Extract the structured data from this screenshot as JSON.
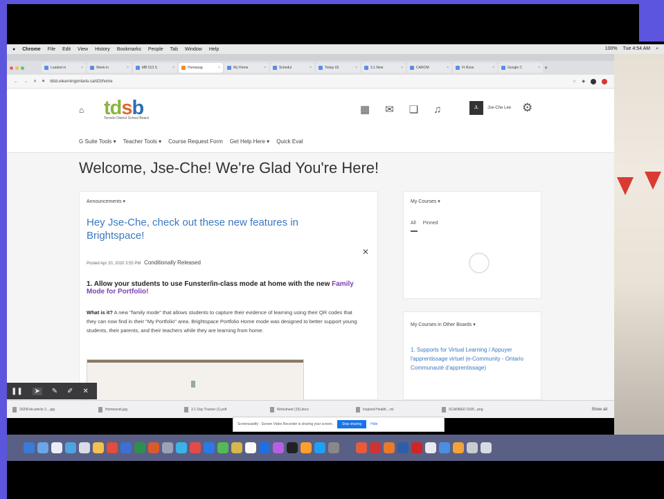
{
  "menubar": {
    "apple": "",
    "items": [
      "Chrome",
      "File",
      "Edit",
      "View",
      "History",
      "Bookmarks",
      "People",
      "Tab",
      "Window",
      "Help"
    ],
    "right": [
      "100%",
      "Tue 4:54 AM"
    ]
  },
  "window_title": "",
  "tabs": [
    {
      "label": "Loaded m",
      "active": false
    },
    {
      "label": "Week in",
      "active": false
    },
    {
      "label": "MB 013 S",
      "active": false
    },
    {
      "label": "Homepag",
      "active": true
    },
    {
      "label": "My Home",
      "active": false
    },
    {
      "label": "Schedul",
      "active": false
    },
    {
      "label": "Today 03",
      "active": false
    },
    {
      "label": "3.1 New",
      "active": false
    },
    {
      "label": "CAROM",
      "active": false
    },
    {
      "label": "Ft Rose",
      "active": false
    },
    {
      "label": "Google C",
      "active": false
    }
  ],
  "address": {
    "url": "tdsb.elearningontario.ca/d2l/home"
  },
  "header": {
    "home_icon": "home-icon",
    "logo": {
      "t": "t",
      "d": "d",
      "s": "s",
      "b": "b"
    },
    "logo_sub": "Toronto District School Board",
    "user_initials": "JL",
    "user_name": "Jse-Che Lee"
  },
  "nav": [
    "G Suite Tools ▾",
    "Teacher Tools ▾",
    "Course Request Form",
    "Get Help Here ▾",
    "Quick Eval"
  ],
  "welcome": "Welcome, Jse-Che! We're Glad You're Here!",
  "announcements": {
    "header": "Announcements  ▾",
    "title": "Hey Jse-Che, check out these new features in Brightspace!",
    "posted": "Posted Apr 20, 2020 3:55 PM",
    "released": "Conditionally Released",
    "feature_prefix": "1. Allow your students to use Funster/in-class mode at home with the new ",
    "feature_link": "Family Mode for Portfolio!",
    "body_label": "What is it?",
    "body": " A new \"family mode\" that allows students to capture their evidence of learning using their QR codes that they can now find in their \"My Portfolio\" area. Brightspace Portfolio Home mode was designed to better support young students, their parents, and their teachers while they are learning from home."
  },
  "my_courses": {
    "header": "My Courses  ▾",
    "tab_all": "All",
    "tab_pinned": "Pinned"
  },
  "other_boards": {
    "header": "My Courses in Other Boards  ▾",
    "link": "1. Supports for Virtual Learning / Appuyer l'apprentissage virtuel (e-Community - Ontario Communauté d'apprentissage)"
  },
  "downloads": [
    {
      "label": "2020Feb-article 2....jpg"
    },
    {
      "label": "Homework.jpg"
    },
    {
      "label": "3.1 Day Tracker (1).pdf"
    },
    {
      "label": "Worksheet (15).docx"
    },
    {
      "label": "Inspired Health....ml"
    },
    {
      "label": "SCANNED 0105...png"
    }
  ],
  "downloads_showall": "Show all",
  "share": {
    "text": "Screencastify - Screen Video Recorder is sharing your screen.",
    "stop": "Stop sharing",
    "hide": "Hide"
  },
  "colors": {
    "accent": "#3a78c0",
    "frame": "#5c55dd",
    "link_purple": "#7b3fb0"
  }
}
